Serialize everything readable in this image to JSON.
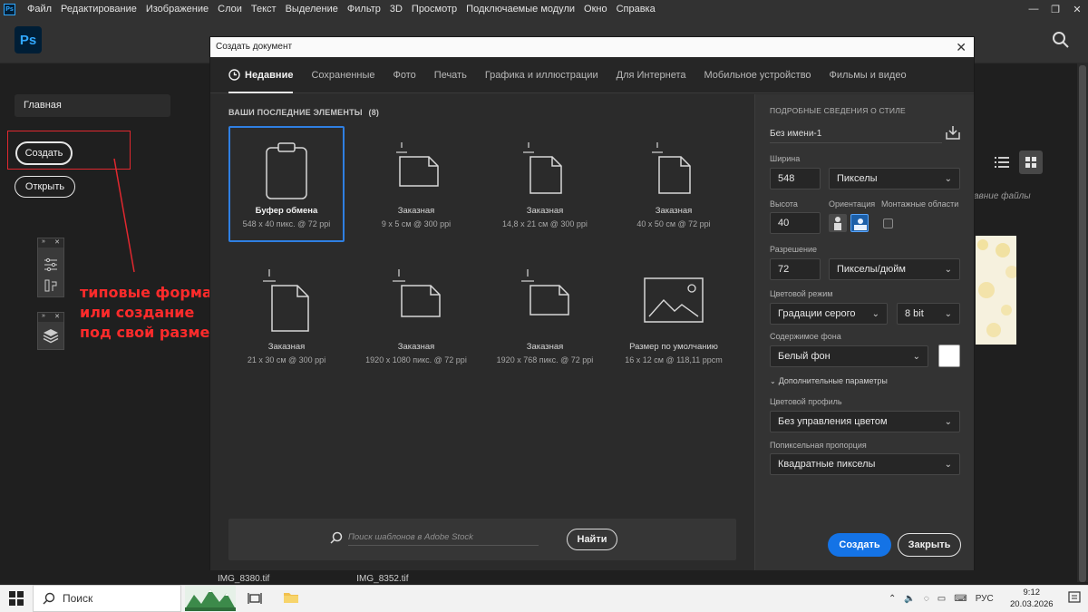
{
  "menubar": {
    "items": [
      "Файл",
      "Редактирование",
      "Изображение",
      "Слои",
      "Текст",
      "Выделение",
      "Фильтр",
      "3D",
      "Просмотр",
      "Подключаемые модули",
      "Окно",
      "Справка"
    ],
    "app_badge": "Ps"
  },
  "app": {
    "logo": "Ps"
  },
  "home": {
    "home_tab": "Главная",
    "create_label": "Создать",
    "open_label": "Открыть",
    "annotation": [
      "типовые форматы",
      "или создание",
      "под свой размер"
    ]
  },
  "background": {
    "files_label": "авние файлы",
    "files": [
      "IMG_8380.tif",
      "IMG_8352.tif"
    ]
  },
  "dialog": {
    "title": "Создать документ",
    "tabs": [
      "Недавние",
      "Сохраненные",
      "Фото",
      "Печать",
      "Графика и иллюстрации",
      "Для Интернета",
      "Мобильное устройство",
      "Фильмы и видео"
    ],
    "active_tab": 0,
    "recent_label": "ВАШИ ПОСЛЕДНИЕ ЭЛЕМЕНТЫ",
    "recent_count": "(8)",
    "presets": [
      {
        "name": "Буфер обмена",
        "size": "548 x 40 пикс. @ 72 ppi",
        "icon": "clipboard-icon"
      },
      {
        "name": "Заказная",
        "size": "9 x 5 см @ 300 ppi",
        "icon": "landscape-doc-icon"
      },
      {
        "name": "Заказная",
        "size": "14,8 x 21 см @ 300 ppi",
        "icon": "portrait-doc-icon"
      },
      {
        "name": "Заказная",
        "size": "40 x 50 см @ 72 ppi",
        "icon": "portrait-doc-icon"
      },
      {
        "name": "Заказная",
        "size": "21 x 30 см @ 300 ppi",
        "icon": "portrait-doc-icon"
      },
      {
        "name": "Заказная",
        "size": "1920 x 1080 пикс. @ 72 ppi",
        "icon": "landscape-doc-icon"
      },
      {
        "name": "Заказная",
        "size": "1920 x 768 пикс. @ 72 ppi",
        "icon": "landscape-doc-icon"
      },
      {
        "name": "Размер по умолчанию",
        "size": "16 x 12 см @ 118,11 ppcm",
        "icon": "image-placeholder-icon"
      }
    ],
    "stock_placeholder": "Поиск шаблонов в Adobe Stock",
    "find_label": "Найти",
    "details": {
      "heading": "ПОДРОБНЫЕ СВЕДЕНИЯ О СТИЛЕ",
      "preset_name": "Без имени-1",
      "width_label": "Ширина",
      "width_value": "548",
      "width_unit": "Пикселы",
      "height_label": "Высота",
      "height_value": "40",
      "orientation_label": "Ориентация",
      "artboards_label": "Монтажные области",
      "resolution_label": "Разрешение",
      "resolution_value": "72",
      "resolution_unit": "Пикселы/дюйм",
      "color_mode_label": "Цветовой режим",
      "color_mode_value": "Градации серого",
      "bit_depth_value": "8 bit",
      "background_label": "Содержимое фона",
      "background_value": "Белый фон",
      "advanced_label": "Дополнительные параметры",
      "profile_label": "Цветовой профиль",
      "profile_value": "Без управления цветом",
      "pixel_aspect_label": "Попиксельная пропорция",
      "pixel_aspect_value": "Квадратные пикселы"
    },
    "create_label": "Создать",
    "close_label": "Закрыть",
    "accent_color": "#1473e6"
  },
  "taskbar": {
    "search_label": "Поиск",
    "language": "РУС",
    "time": "9:12",
    "date": "20.03.2026"
  }
}
